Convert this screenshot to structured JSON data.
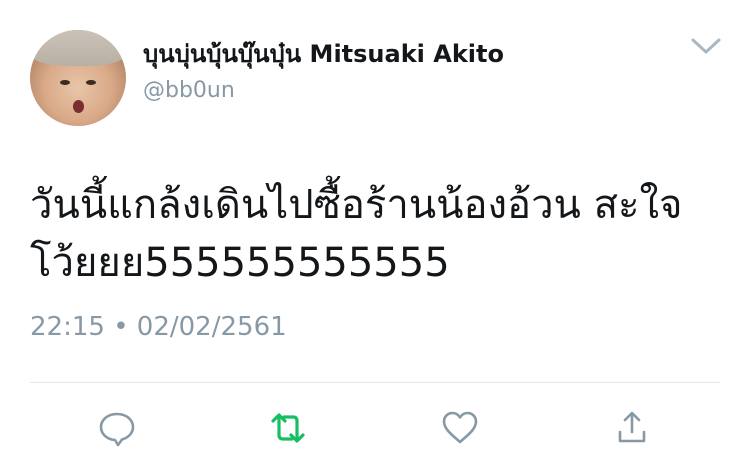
{
  "tweet": {
    "display_name": "บุนบุ่นบุ้นบุ๊นบุ๋น Mitsuaki Akito",
    "handle": "@bb0un",
    "text_line_1": "วันนี้แกล้งเดินไปซื้อร้านน้องอ้วน สะใจ",
    "text_line_2": "โว้ยยย555555555555",
    "timestamp": "22:15 • 02/02/2561"
  },
  "icons": {
    "avatar": "profile-photo",
    "menu": "chevron-down-icon",
    "reply": "reply-icon",
    "retweet": "retweet-icon",
    "like": "heart-icon",
    "share": "share-icon"
  },
  "colors": {
    "text": "#14171a",
    "secondary": "#8899a6",
    "retweet_active": "#17bf63",
    "divider": "#e1e8ed"
  }
}
